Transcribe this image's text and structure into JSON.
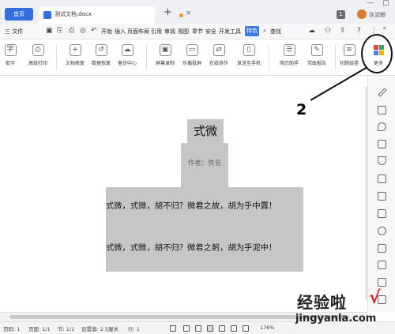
{
  "titlebar": {
    "home_tab": "首页",
    "doc_tab": "测试文档.docx",
    "close": "×",
    "new_tab": "+",
    "badge": "1",
    "user_name": "灰泥鲫",
    "min": "—",
    "max": "▢"
  },
  "menubar": {
    "file": "三 文件",
    "items": [
      "开始",
      "插入",
      "页面布局",
      "引用",
      "审阅",
      "视图",
      "章节",
      "安全",
      "开发工具"
    ],
    "special": "特色",
    "search": "查找",
    "help": "?"
  },
  "ribbon": {
    "buttons": [
      {
        "label": "取字",
        "glyph": "字"
      },
      {
        "label": "高级打印",
        "glyph": "⎙"
      },
      {
        "label": "文档修复",
        "glyph": "+"
      },
      {
        "label": "数据恢复",
        "glyph": "↺"
      },
      {
        "label": "备份中心",
        "glyph": "☁"
      },
      {
        "label": "屏幕录制",
        "glyph": "▣"
      },
      {
        "label": "乐播投屏",
        "glyph": "▭"
      },
      {
        "label": "在线协作",
        "glyph": "⇄"
      },
      {
        "label": "发送至手机",
        "glyph": "▯"
      },
      {
        "label": "简历助手",
        "glyph": "☰"
      },
      {
        "label": "党政报告",
        "glyph": "✎"
      },
      {
        "label": "切题组卷",
        "glyph": "≡"
      }
    ],
    "more_label": "更多"
  },
  "annotation": {
    "number": "2"
  },
  "document": {
    "title": "式微",
    "author": "作者：佚名",
    "lines": [
      "式微，式微，胡不归？微君之故，胡为乎中露！",
      "式微，式微，胡不归？微君之躬，胡为乎泥中！"
    ]
  },
  "statusbar": {
    "page_num": "页码: 1",
    "pages": "页面: 1/1",
    "section": "节: 1/1",
    "position": "设置值: 2.5厘米",
    "row": "行: 1",
    "zoom": "176%"
  },
  "watermark": {
    "text": "经验啦",
    "check": "√",
    "url": "jingyanla.com"
  }
}
